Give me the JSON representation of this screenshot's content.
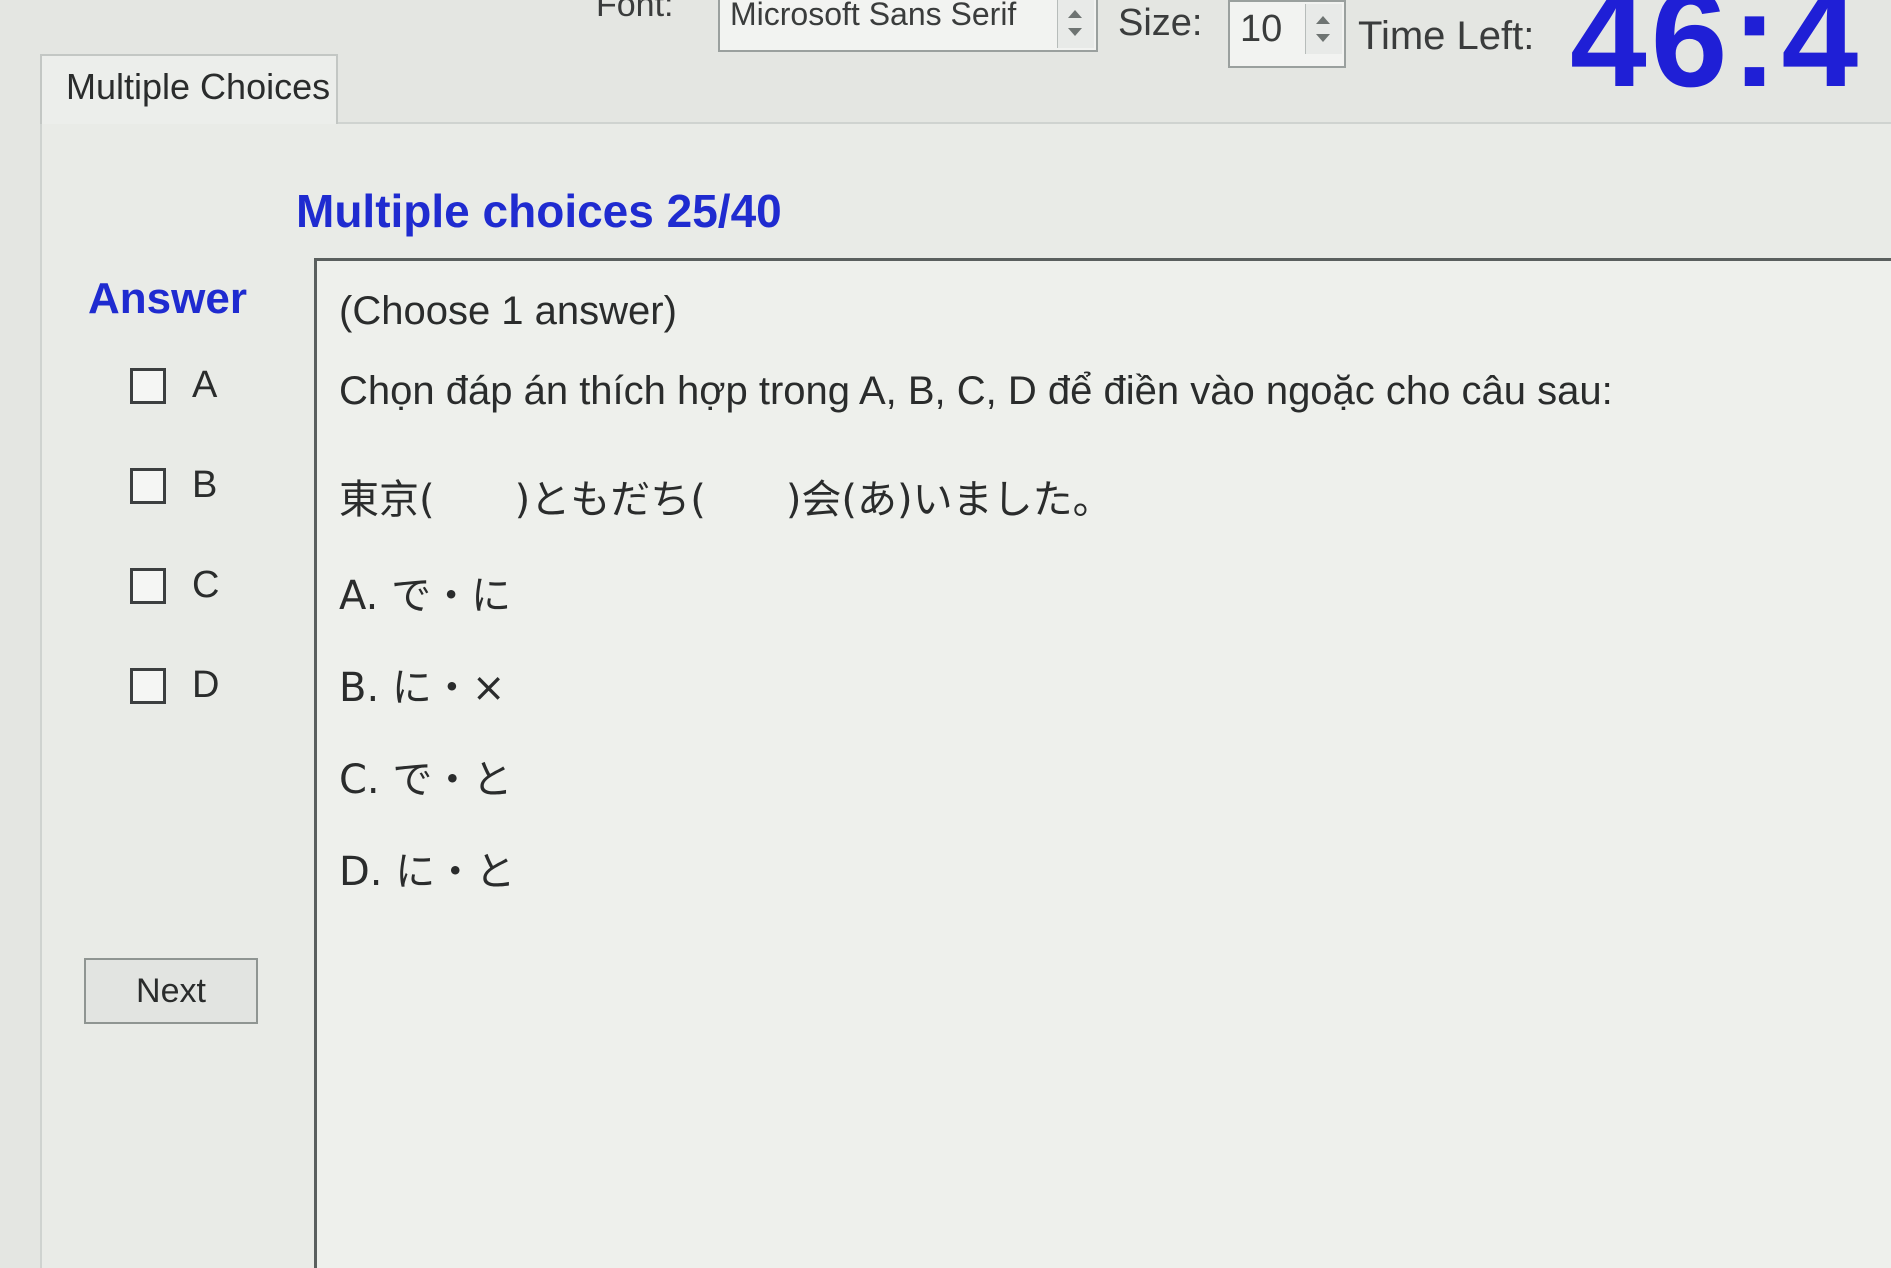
{
  "toolbar": {
    "font_label": "Font:",
    "font_value": "Microsoft Sans Serif",
    "size_label": "Size:",
    "size_value": "10",
    "time_left_label": "Time Left:",
    "time_left_value": "46:4"
  },
  "tab": {
    "label": "Multiple Choices"
  },
  "section": {
    "title": "Multiple choices 25/40"
  },
  "answer_panel": {
    "title": "Answer",
    "options": [
      {
        "letter": "A",
        "checked": false
      },
      {
        "letter": "B",
        "checked": false
      },
      {
        "letter": "C",
        "checked": false
      },
      {
        "letter": "D",
        "checked": false
      }
    ],
    "next_label": "Next"
  },
  "question": {
    "instruction": "(Choose 1 answer)",
    "prompt": "Chọn đáp án thích hợp trong A, B, C, D để điền vào ngoặc cho câu sau:",
    "sentence": "東京(　　)ともだち(　　)会(あ)いました。",
    "options": [
      "A. で・に",
      "B. に・×",
      "C. で・と",
      "D. に・と"
    ]
  }
}
